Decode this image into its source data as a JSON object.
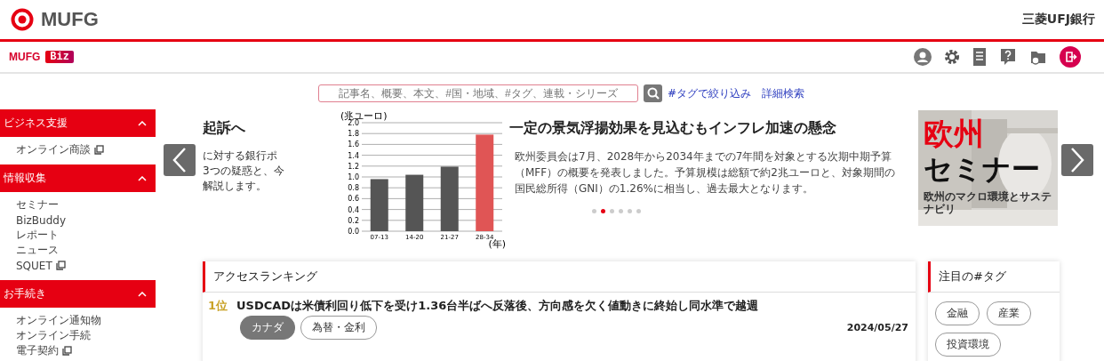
{
  "header": {
    "logo_text": "MUFG",
    "bank_name": "三菱UFJ銀行"
  },
  "subheader": {
    "brand": "MUFG",
    "brand_badge": "Biz"
  },
  "sidebar": {
    "sections": [
      {
        "title": "ビジネス支援",
        "expanded": true,
        "items": [
          {
            "label": "オンライン商談",
            "external": true
          }
        ]
      },
      {
        "title": "情報収集",
        "expanded": true,
        "items": [
          {
            "label": "セミナー",
            "external": false
          },
          {
            "label": "BizBuddy",
            "external": false
          },
          {
            "label": "レポート",
            "external": false
          },
          {
            "label": "ニュース",
            "external": false
          },
          {
            "label": "SQUET",
            "external": true
          }
        ]
      },
      {
        "title": "お手続き",
        "expanded": true,
        "items": [
          {
            "label": "オンライン通知物",
            "external": false
          },
          {
            "label": "オンライン手続",
            "external": false
          },
          {
            "label": "電子契約",
            "external": true
          }
        ]
      }
    ]
  },
  "search": {
    "placeholder": "記事名、概要、本文、#国・地域、#タグ、連載・シリーズ",
    "links": [
      "#タグで絞り込み",
      "詳細検索"
    ]
  },
  "carousel": {
    "prev_slide": {
      "title": "起訴へ",
      "lines": [
        "に対する銀行ポ",
        "3つの疑惑と、今",
        "解説します。"
      ]
    },
    "slide": {
      "title": "一定の景気浮揚効果を見込むもインフレ加速の懸念",
      "body": "欧州委員会は7月、2028年から2034年までの7年間を対象とする次期中期予算（MFF）の概要を発表しました。予算規模は総額で約2兆ユーロと、対象期間の国民総所得（GNI）の1.26%に相当し、過去最大となります。",
      "chart_data": {
        "type": "bar",
        "ylabel": "(兆ユーロ)",
        "xlabel": "(年)",
        "categories": [
          "07-13",
          "14-20",
          "21-27",
          "28-34"
        ],
        "series": [
          {
            "color": "#555555",
            "values": [
              0.96,
              1.04,
              1.19,
              null
            ]
          },
          {
            "color": "#e05555",
            "values": [
              null,
              null,
              null,
              1.78
            ]
          }
        ],
        "stacked": true,
        "grid": true,
        "ylim": [
          0,
          2
        ],
        "yticks": [
          {
            "value": 0,
            "label": "0.0"
          },
          {
            "value": 0.2,
            "label": "0.2"
          },
          {
            "value": 0.4,
            "label": "0.4"
          },
          {
            "value": 0.6,
            "label": "0.6"
          },
          {
            "value": 0.8,
            "label": "0.8"
          },
          {
            "value": 1,
            "label": "1.0"
          },
          {
            "value": 1.2,
            "label": "1.2"
          },
          {
            "value": 1.4,
            "label": "1.4"
          },
          {
            "value": 1.6,
            "label": "1.6"
          },
          {
            "value": 1.8,
            "label": "1.8"
          },
          {
            "value": 2,
            "label": "2.0"
          }
        ]
      }
    },
    "dots": [
      {
        "selected": false
      },
      {
        "selected": true
      },
      {
        "selected": false
      },
      {
        "selected": false
      },
      {
        "selected": false
      },
      {
        "selected": false
      }
    ],
    "banner": {
      "title_1": "欧州",
      "title_2": "セミナー",
      "subtitle": "欧州のマクロ環境とサステナビリ"
    }
  },
  "ranking": {
    "title": "アクセスランキング",
    "items": [
      {
        "rank": "1位",
        "title": "USDCADは米債利回り低下を受け1.36台半ばへ反落後、方向感を欠く値動きに終始し同水準で越週",
        "tags": [
          {
            "label": "カナダ",
            "selected": true
          },
          {
            "label": "為替・金利",
            "selected": false
          }
        ],
        "date": "2024/05/27"
      }
    ]
  },
  "hot_tags": {
    "title": "注目の#タグ",
    "tags": [
      "金融",
      "産業",
      "投資環境"
    ]
  }
}
